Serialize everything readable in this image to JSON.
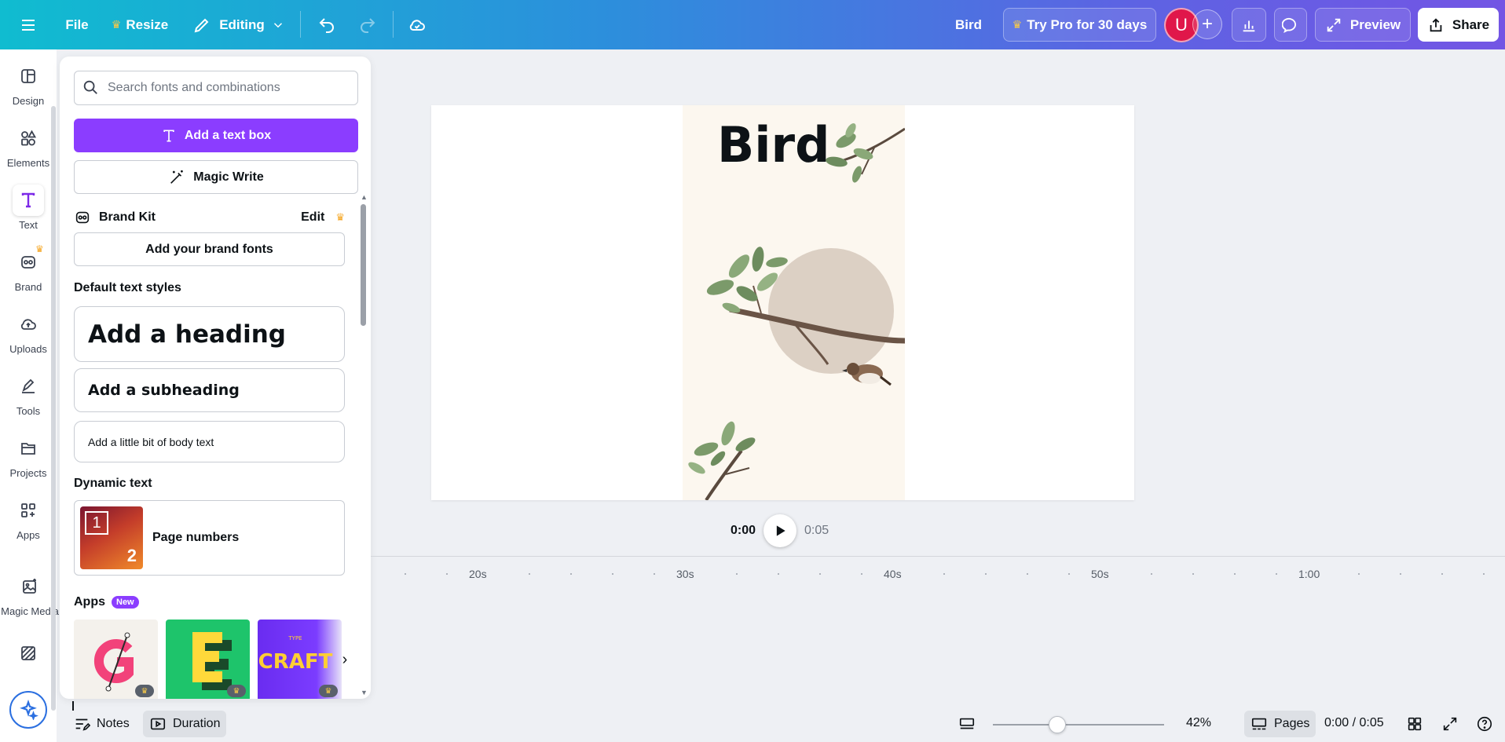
{
  "topbar": {
    "menu_icon": "hamburger-icon",
    "file_label": "File",
    "resize_label": "Resize",
    "editing_label": "Editing",
    "design_name": "Bird",
    "try_pro_label": "Try Pro for 30 days",
    "avatar_initial": "U",
    "preview_label": "Preview",
    "share_label": "Share",
    "accent_gradient": [
      "#10bcd0",
      "#7355e4"
    ]
  },
  "rail": {
    "items": [
      {
        "label": "Design",
        "icon": "layout-icon"
      },
      {
        "label": "Elements",
        "icon": "shapes-icon"
      },
      {
        "label": "Text",
        "icon": "text-icon"
      },
      {
        "label": "Brand",
        "icon": "brand-icon"
      },
      {
        "label": "Uploads",
        "icon": "cloud-upload-icon"
      },
      {
        "label": "Tools",
        "icon": "pen-icon"
      },
      {
        "label": "Projects",
        "icon": "folder-icon"
      },
      {
        "label": "Apps",
        "icon": "grid-plus-icon"
      },
      {
        "label": "Magic Media",
        "icon": "magic-media-icon"
      }
    ]
  },
  "panel": {
    "search_placeholder": "Search fonts and combinations",
    "add_text_box": "Add a text box",
    "magic_write": "Magic Write",
    "brand_kit": "Brand Kit",
    "brand_edit": "Edit",
    "add_brand_fonts": "Add your brand fonts",
    "default_styles_title": "Default text styles",
    "heading": "Add a heading",
    "subheading": "Add a subheading",
    "body": "Add a little bit of body text",
    "dynamic_title": "Dynamic text",
    "page_numbers": "Page numbers",
    "dyn_thumb_a": "1",
    "dyn_thumb_b": "2",
    "apps_title": "Apps",
    "apps_badge": "New",
    "primary_color": "#8b3dff"
  },
  "canvas": {
    "title": "Bird"
  },
  "playback": {
    "current": "0:00",
    "end": "0:05"
  },
  "timeline": {
    "ticks": [
      "20s",
      "30s",
      "40s",
      "50s",
      "1:00"
    ]
  },
  "bottombar": {
    "notes": "Notes",
    "duration": "Duration",
    "zoom": "42%",
    "pages": "Pages",
    "time": "0:00 / 0:05",
    "zoom_level": 0.42
  }
}
